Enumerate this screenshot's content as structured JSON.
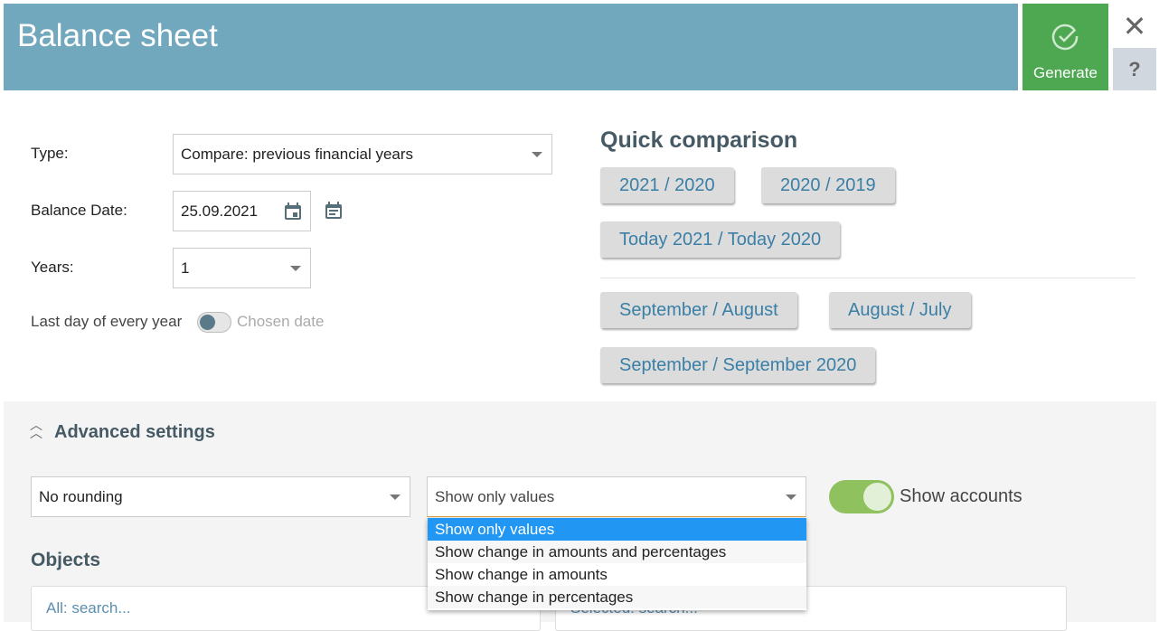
{
  "header": {
    "title": "Balance sheet",
    "generate_label": "Generate",
    "close_icon": "close-icon",
    "help_label": "?"
  },
  "form": {
    "type_label": "Type:",
    "type_value": "Compare: previous financial years",
    "date_label": "Balance Date:",
    "date_value": "25.09.2021",
    "years_label": "Years:",
    "years_value": "1",
    "toggle_left": "Last day of every year",
    "toggle_right": "Chosen date",
    "toggle_on": false
  },
  "quick": {
    "title": "Quick comparison",
    "buttons": [
      "2021 / 2020",
      "2020 / 2019",
      "Today 2021 / Today 2020",
      "September / August",
      "August / July",
      "September / September 2020"
    ]
  },
  "advanced": {
    "title": "Advanced settings",
    "rounding_value": "No rounding",
    "display_value": "Show only values",
    "display_options": [
      "Show only values",
      "Show change in amounts and percentages",
      "Show change in amounts",
      "Show change in percentages"
    ],
    "show_accounts_label": "Show accounts",
    "show_accounts_on": true,
    "objects_title": "Objects",
    "all_search_placeholder": "All: search...",
    "selected_search_placeholder": "Selected: search..."
  },
  "colors": {
    "header": "#72a8bd",
    "generate": "#4ea852",
    "accent": "#3a7fa6",
    "toggle_on": "#8fc15f",
    "selected_option": "#2196f3"
  }
}
